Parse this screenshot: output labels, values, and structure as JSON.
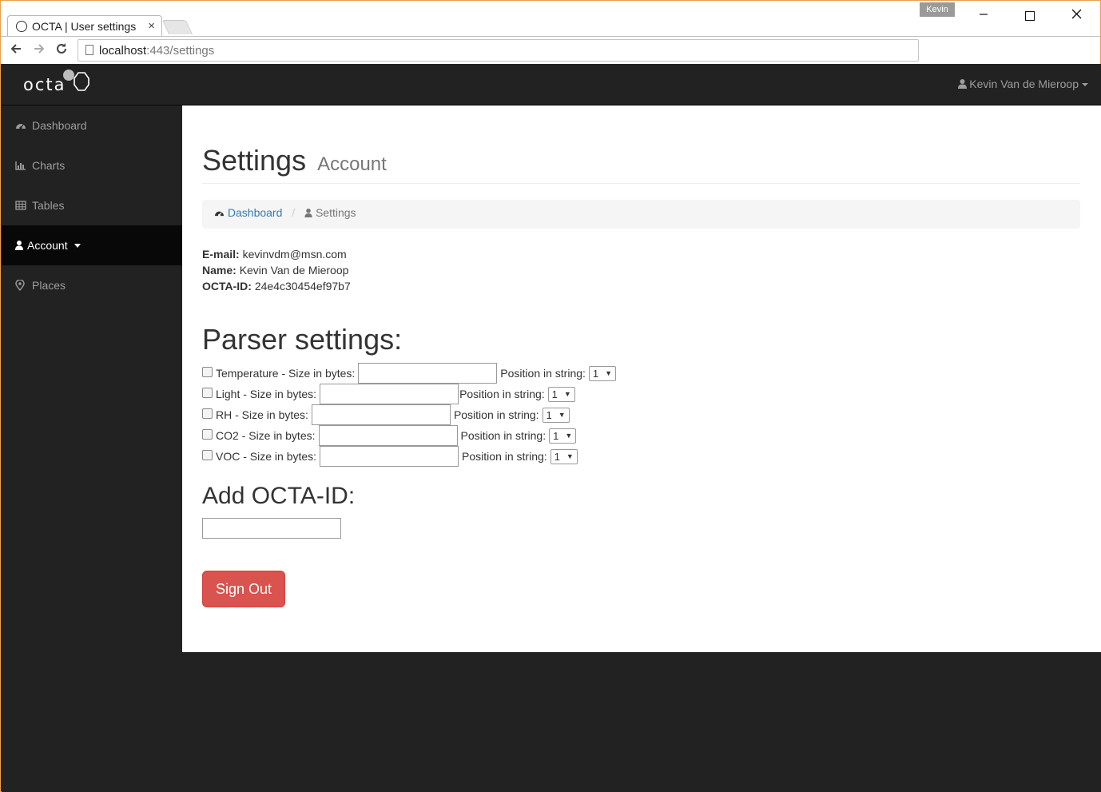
{
  "browser": {
    "tab_title": "OCTA | User settings",
    "tab_close": "×",
    "profile_name": "Kevin",
    "url_host": "localhost",
    "url_rest": ":443/settings"
  },
  "app": {
    "brand": "octa",
    "user_name": "Kevin Van de Mieroop",
    "sidebar": [
      {
        "label": "Dashboard",
        "icon": "dashboard-icon"
      },
      {
        "label": "Charts",
        "icon": "bar-chart-icon"
      },
      {
        "label": "Tables",
        "icon": "table-icon"
      },
      {
        "label": "Account",
        "icon": "user-icon",
        "active": true
      },
      {
        "label": "Places",
        "icon": "map-marker-icon"
      }
    ]
  },
  "page": {
    "title": "Settings",
    "subtitle": "Account",
    "breadcrumb": {
      "home": "Dashboard",
      "separator": "/",
      "current": "Settings"
    },
    "account": {
      "email_label": "E-mail:",
      "email": "kevinvdm@msn.com",
      "name_label": "Name:",
      "name": "Kevin Van de Mieroop",
      "octa_id_label": "OCTA-ID:",
      "octa_id": "24e4c30454ef97b7"
    },
    "parser_heading": "Parser settings:",
    "parser_rows": [
      {
        "label": "Temperature - Size in bytes:",
        "position_label": "Position in string:",
        "position": "1"
      },
      {
        "label": "Light - Size in bytes:",
        "position_label": "Position in string:",
        "position": "1"
      },
      {
        "label": "RH - Size in bytes:",
        "position_label": "Position in string:",
        "position": "1"
      },
      {
        "label": "CO2 - Size in bytes:",
        "position_label": "Position in string:",
        "position": "1"
      },
      {
        "label": "VOC - Size in bytes:",
        "position_label": "Position in string:",
        "position": "1"
      }
    ],
    "add_octa_heading": "Add OCTA-ID:",
    "sign_out": "Sign Out"
  },
  "colors": {
    "danger": "#d9534f",
    "link": "#337ab7",
    "nav": "#222222"
  }
}
